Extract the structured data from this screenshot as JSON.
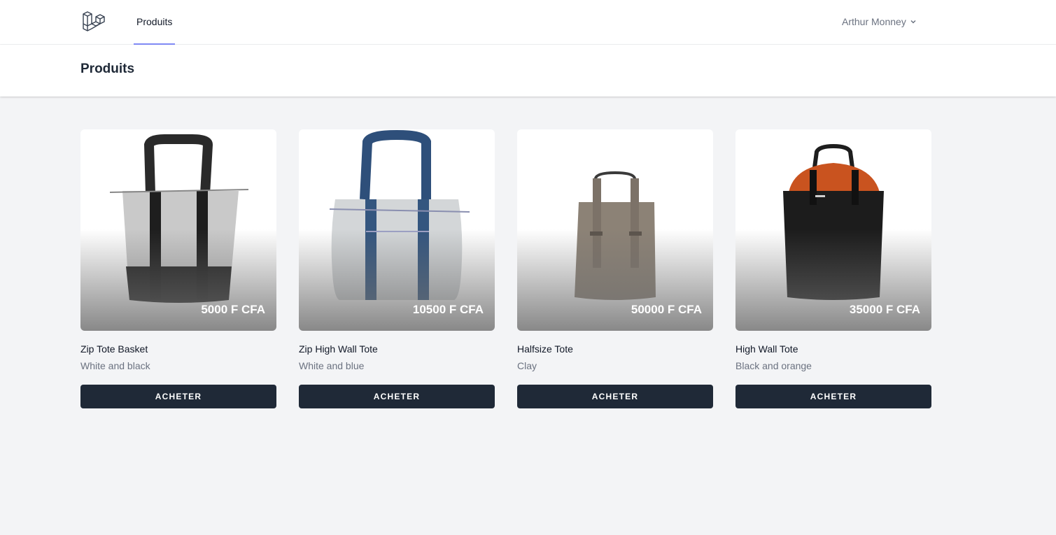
{
  "nav": {
    "link_label": "Produits"
  },
  "user": {
    "name": "Arthur Monney"
  },
  "header": {
    "title": "Produits"
  },
  "products": [
    {
      "name": "Zip Tote Basket",
      "description": "White and black",
      "price": "5000 F CFA",
      "button_label": "ACHETER"
    },
    {
      "name": "Zip High Wall Tote",
      "description": "White and blue",
      "price": "10500 F CFA",
      "button_label": "ACHETER"
    },
    {
      "name": "Halfsize Tote",
      "description": "Clay",
      "price": "50000 F CFA",
      "button_label": "ACHETER"
    },
    {
      "name": "High Wall Tote",
      "description": "Black and orange",
      "price": "35000 F CFA",
      "button_label": "ACHETER"
    }
  ],
  "colors": {
    "accent": "#818cf8",
    "button_bg": "#1f2937",
    "page_bg": "#f3f4f6"
  }
}
